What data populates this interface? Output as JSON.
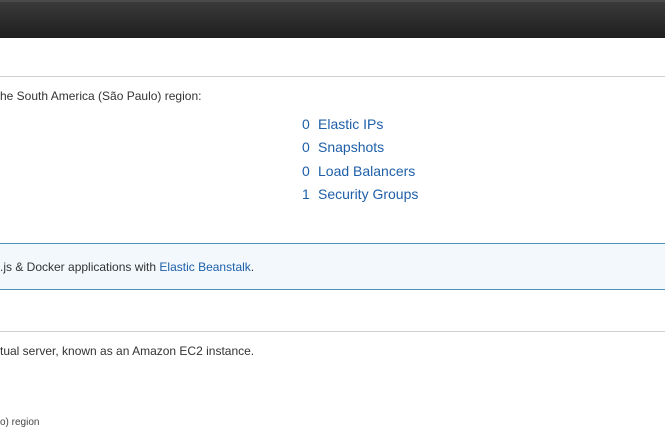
{
  "region_intro": "he South America (São Paulo) region:",
  "resources": [
    {
      "count": "0",
      "label": "Elastic IPs"
    },
    {
      "count": "0",
      "label": "Snapshots"
    },
    {
      "count": "0",
      "label": "Load Balancers"
    },
    {
      "count": "1",
      "label": "Security Groups"
    }
  ],
  "beanstalk_notice": {
    "text": ".js & Docker applications with ",
    "link": "Elastic Beanstalk",
    "suffix": "."
  },
  "launch_description": "tual server, known as an Amazon EC2 instance.",
  "region_footer": "o) region"
}
